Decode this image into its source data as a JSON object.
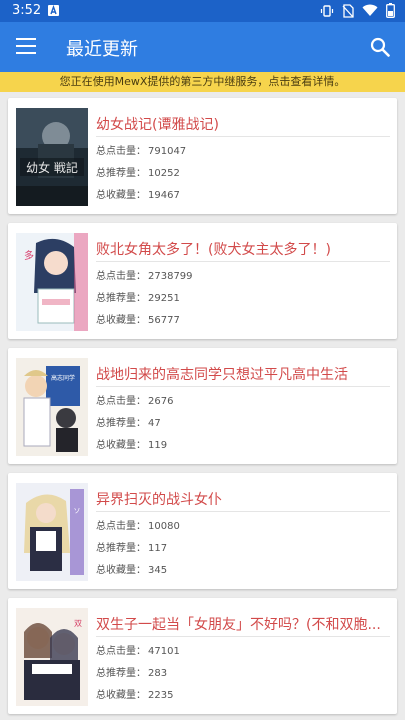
{
  "status": {
    "time": "3:52"
  },
  "app": {
    "title": "最近更新"
  },
  "notice": {
    "text": "您正在使用MewX提供的第三方中继服务，点击查看详情。"
  },
  "labels": {
    "clicks": "总点击量：",
    "recommend": "总推荐量：",
    "favorites": "总收藏量："
  },
  "novels": [
    {
      "title": "幼女战记(谭雅战记)",
      "clicks": "791047",
      "recommend": "10252",
      "favorites": "19467"
    },
    {
      "title": "败北女角太多了！(败犬女主太多了！)",
      "clicks": "2738799",
      "recommend": "29251",
      "favorites": "56777"
    },
    {
      "title": "战地归来的高志同学只想过平凡高中生活",
      "clicks": "2676",
      "recommend": "47",
      "favorites": "119"
    },
    {
      "title": "异界扫灭的战斗女仆",
      "clicks": "10080",
      "recommend": "117",
      "favorites": "345"
    },
    {
      "title": "双生子一起当「女朋友」不好吗？(不和双胞...",
      "clicks": "47101",
      "recommend": "283",
      "favorites": "2235"
    }
  ],
  "colors": {
    "app_bar": "#2f7de1",
    "status_bar": "#1c62c8",
    "notice": "#f6d44c",
    "title": "#d24a4a"
  }
}
